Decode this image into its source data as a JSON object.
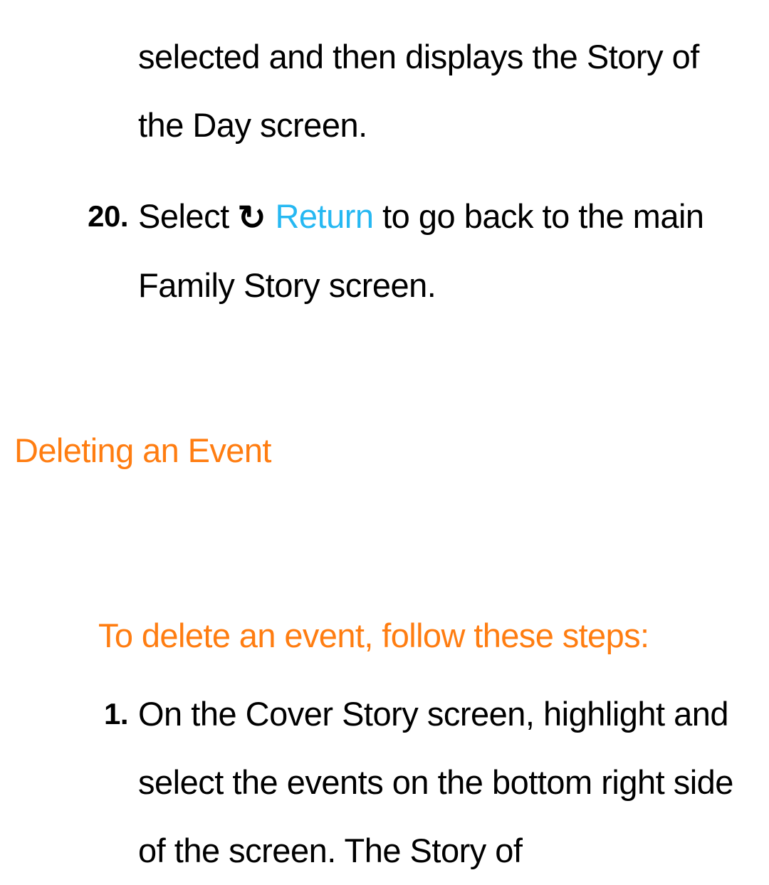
{
  "continuation_text": "selected and then displays the Story of the Day screen.",
  "step20": {
    "number": "20.",
    "pre": "Select ",
    "icon_glyph": "↺",
    "return_label": " Return",
    "post": " to go back to the main Family Story screen."
  },
  "section_heading": "Deleting an Event",
  "sub_heading": "To delete an event, follow these steps:",
  "step1": {
    "number": "1.",
    "text": "On the Cover Story screen, highlight and select the events on the bottom right side of the screen. The Story of"
  }
}
